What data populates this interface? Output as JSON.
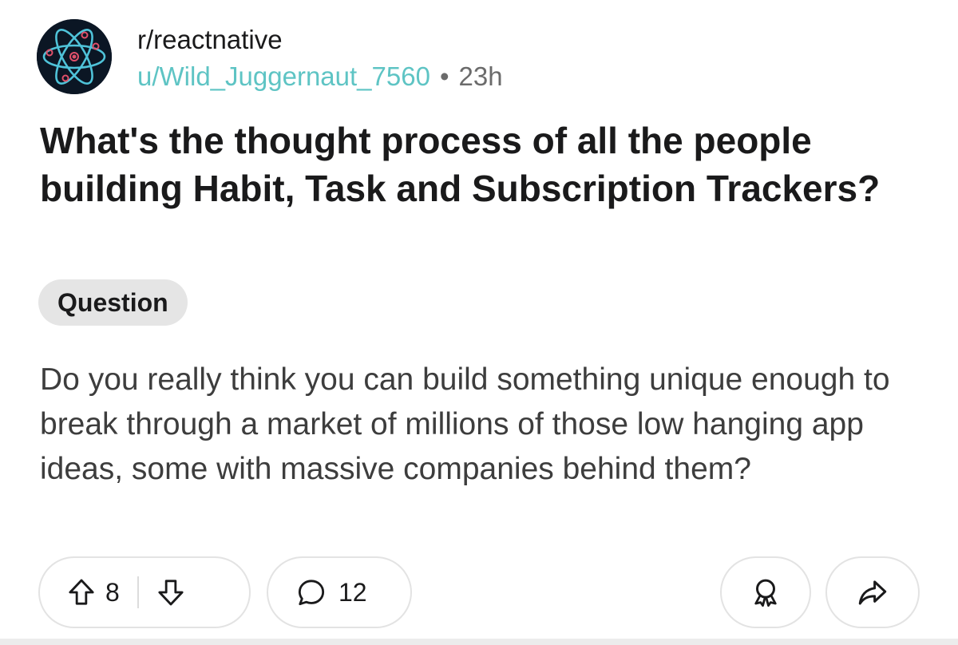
{
  "post": {
    "subreddit": "r/reactnative",
    "author": "u/Wild_Juggernaut_7560",
    "separator": "•",
    "age": "23h",
    "title": "What's the thought process of all the people building Habit, Task and Subscription Trackers?",
    "flair": "Question",
    "body": "Do you really think you can build something unique enough to break through a market of millions of those low hanging app ideas, some with massive companies behind them?"
  },
  "actions": {
    "upvotes": "8",
    "comments": "12"
  },
  "icons": {
    "avatar": "react-atom-icon",
    "upvote": "arrow-up-icon",
    "downvote": "arrow-down-icon",
    "comment": "speech-bubble-icon",
    "award": "award-icon",
    "share": "share-arrow-icon"
  },
  "colors": {
    "username": "#5ec4c4",
    "avatar_bg": "#0b1624",
    "atom": "#4fc3d9",
    "flair_bg": "#e5e5e5"
  }
}
